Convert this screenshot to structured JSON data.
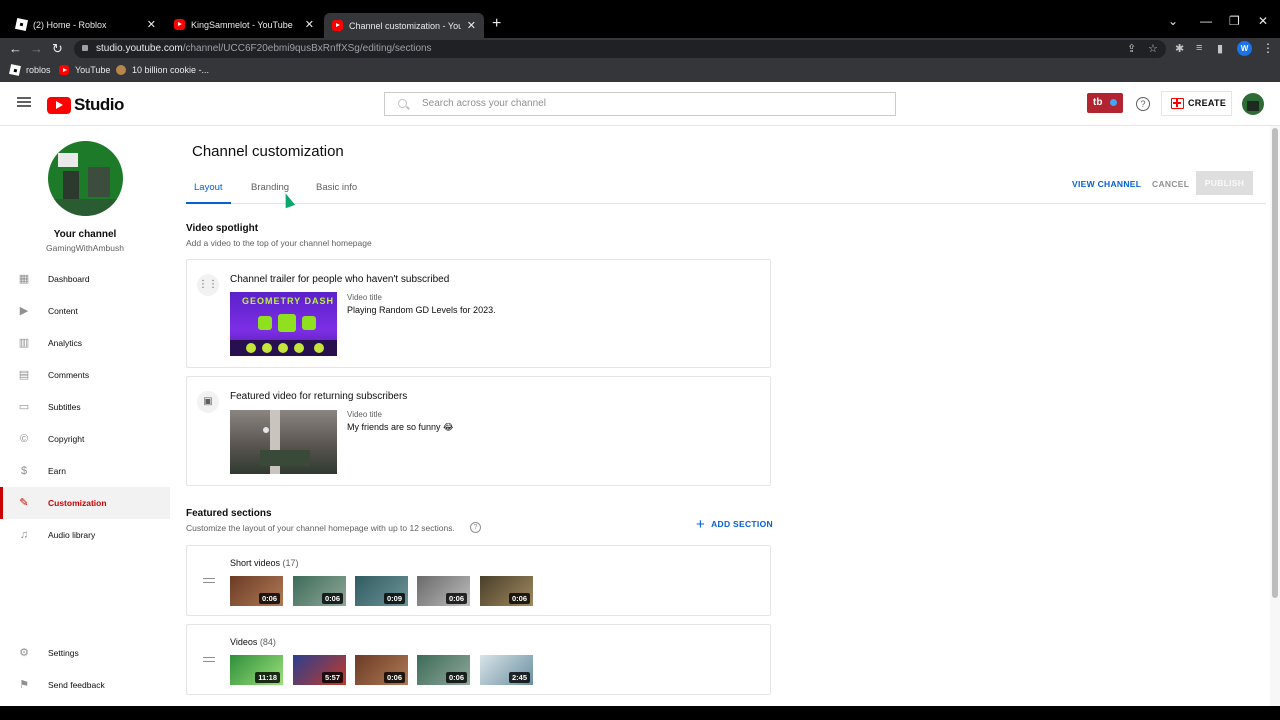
{
  "browser": {
    "tabs": [
      {
        "title": "(2) Home - Roblox",
        "icon": "roblox-icon"
      },
      {
        "title": "KingSammelot - YouTube",
        "icon": "youtube-icon"
      },
      {
        "title": "Channel customization - YouTube",
        "icon": "youtube-icon"
      }
    ],
    "new_tab": "+",
    "url_host": "studio.youtube.com",
    "url_path": "/channel/UCC6F20ebmi9qusBxRnffXSg/editing/sections",
    "profile_initial": "W",
    "bookmarks": [
      {
        "label": "roblos",
        "icon": "roblox-icon"
      },
      {
        "label": "YouTube",
        "icon": "youtube-icon"
      },
      {
        "label": "10 billion cookie -...",
        "icon": "cookie-icon"
      }
    ]
  },
  "studio": {
    "logo_text": "Studio",
    "search_placeholder": "Search across your channel",
    "badge_text": "tb",
    "help_glyph": "?",
    "create_label": "CREATE"
  },
  "sidebar": {
    "your_channel": "Your channel",
    "handle": "GamingWithAmbush",
    "items": [
      {
        "label": "Dashboard",
        "icon": "dashboard-icon"
      },
      {
        "label": "Content",
        "icon": "content-icon"
      },
      {
        "label": "Analytics",
        "icon": "analytics-icon"
      },
      {
        "label": "Comments",
        "icon": "comments-icon"
      },
      {
        "label": "Subtitles",
        "icon": "subtitles-icon"
      },
      {
        "label": "Copyright",
        "icon": "copyright-icon"
      },
      {
        "label": "Earn",
        "icon": "earn-icon"
      },
      {
        "label": "Customization",
        "icon": "customization-icon"
      },
      {
        "label": "Audio library",
        "icon": "audio-library-icon"
      }
    ],
    "active_item": "Customization",
    "bottom_items": [
      {
        "label": "Settings",
        "icon": "settings-icon"
      },
      {
        "label": "Send feedback",
        "icon": "feedback-icon"
      }
    ]
  },
  "main": {
    "title": "Channel customization",
    "tabs": [
      "Layout",
      "Branding",
      "Basic info"
    ],
    "active_tab": "Layout",
    "view_channel": "VIEW CHANNEL",
    "cancel": "CANCEL",
    "publish": "PUBLISH",
    "spotlight": {
      "title": "Video spotlight",
      "subtitle": "Add a video to the top of your channel homepage",
      "trailer": {
        "title": "Channel trailer for people who haven't subscribed",
        "video_title_label": "Video title",
        "video_title": "Playing Random GD Levels for 2023.",
        "thumb_text": "GEOMETRY DASH"
      },
      "featured": {
        "title": "Featured video for returning subscribers",
        "video_title_label": "Video title",
        "video_title": "My friends are so funny 😂"
      }
    },
    "featured_sections": {
      "title": "Featured sections",
      "subtitle": "Customize the layout of your channel homepage with up to 12 sections.",
      "add_section": "ADD SECTION",
      "rows": [
        {
          "title": "Short videos",
          "count": "(17)",
          "durations": [
            "0:06",
            "0:06",
            "0:09",
            "0:06",
            "0:06"
          ]
        },
        {
          "title": "Videos",
          "count": "(84)",
          "durations": [
            "11:18",
            "5:57",
            "0:06",
            "0:06",
            "2:45"
          ]
        }
      ]
    }
  },
  "colors": {
    "accent_blue": "#065fd4",
    "active_red": "#cc0000",
    "yt_red": "#ff0000"
  }
}
